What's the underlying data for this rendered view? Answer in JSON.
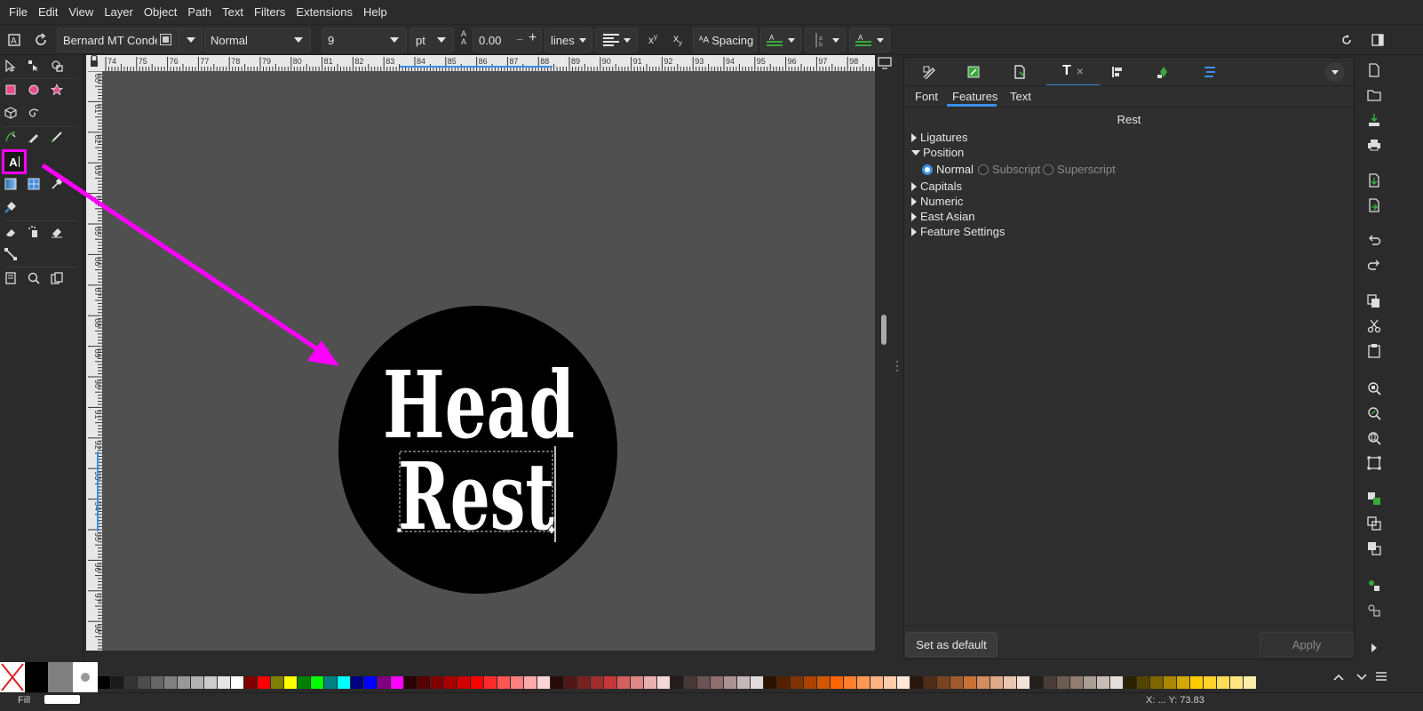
{
  "menu": [
    "File",
    "Edit",
    "View",
    "Layer",
    "Object",
    "Path",
    "Text",
    "Filters",
    "Extensions",
    "Help"
  ],
  "toolbar": {
    "font_family": "Bernard MT Conder",
    "font_style": "Normal",
    "font_size": "9",
    "unit": "pt",
    "letter_spacing": "0.00",
    "line_height_unit": "lines",
    "spacing_label": "Spacing"
  },
  "canvas": {
    "text_line1": "Head",
    "text_line2": "Rest",
    "ruler_top": [
      "74",
      "75",
      "76",
      "77",
      "78",
      "79",
      "80",
      "81",
      "82",
      "83",
      "84",
      "85",
      "86",
      "87",
      "88",
      "89",
      "90",
      "91",
      "92",
      "93",
      "94",
      "95",
      "96",
      "97",
      "98"
    ],
    "ruler_left": [
      "80",
      "81",
      "82",
      "83",
      "84",
      "85",
      "86",
      "87",
      "88",
      "89",
      "90",
      "91",
      "92",
      "93",
      "94",
      "95",
      "96",
      "97",
      "98"
    ]
  },
  "panel": {
    "subtabs": [
      "Font",
      "Features",
      "Text"
    ],
    "active_subtab": "Features",
    "preview_text": "Rest",
    "features": {
      "ligatures": "Ligatures",
      "position": "Position",
      "position_options": [
        "Normal",
        "Subscript",
        "Superscript"
      ],
      "capitals": "Capitals",
      "numeric": "Numeric",
      "east_asian": "East Asian",
      "feature_settings": "Feature Settings"
    },
    "set_default_label": "Set as default",
    "apply_label": "Apply"
  },
  "colors": {
    "accent": "#3b8fe8",
    "highlight": "#ff00ff",
    "canvas_bg": "#505050",
    "circle": "#000000",
    "text": "#ffffff"
  },
  "palette": [
    "#000000",
    "#1a1a1a",
    "#333333",
    "#4d4d4d",
    "#666666",
    "#808080",
    "#999999",
    "#b3b3b3",
    "#cccccc",
    "#e6e6e6",
    "#ffffff",
    "#800000",
    "#ff0000",
    "#808000",
    "#ffff00",
    "#008000",
    "#00ff00",
    "#008080",
    "#00ffff",
    "#000080",
    "#0000ff",
    "#800080",
    "#ff00ff",
    "#2b0000",
    "#550000",
    "#800000",
    "#aa0000",
    "#d40000",
    "#ff0000",
    "#ff2a2a",
    "#ff5555",
    "#ff8080",
    "#ffaaaa",
    "#ffd5d5",
    "#280b0b",
    "#501616",
    "#782121",
    "#a02c2c",
    "#c83737",
    "#d35f5f",
    "#de8787",
    "#e9afaf",
    "#f4d7d7",
    "#241c1c",
    "#483737",
    "#6c5353",
    "#916f6f",
    "#ac9393",
    "#c8b7b7",
    "#e3dbdb",
    "#2b1100",
    "#552200",
    "#803300",
    "#aa4400",
    "#d45500",
    "#ff6600",
    "#ff7f2a",
    "#ff9955",
    "#ffb380",
    "#ffccaa",
    "#ffe6d5",
    "#28170b",
    "#502d16",
    "#784421",
    "#a05a2c",
    "#c87137",
    "#d38d5f",
    "#deaa87",
    "#e9c6af",
    "#f4e3d7",
    "#241f1c",
    "#483e37",
    "#6c5d53",
    "#917c6f",
    "#ac9d93",
    "#c8beb7",
    "#e3dedb",
    "#2b2200",
    "#554400",
    "#806600",
    "#aa8800",
    "#d4aa00",
    "#ffcc00",
    "#ffd42a",
    "#ffdd55",
    "#ffe680",
    "#ffeeaa"
  ],
  "status": {
    "fill_label": "Fill",
    "coords": "X: ... Y: 73.83"
  }
}
